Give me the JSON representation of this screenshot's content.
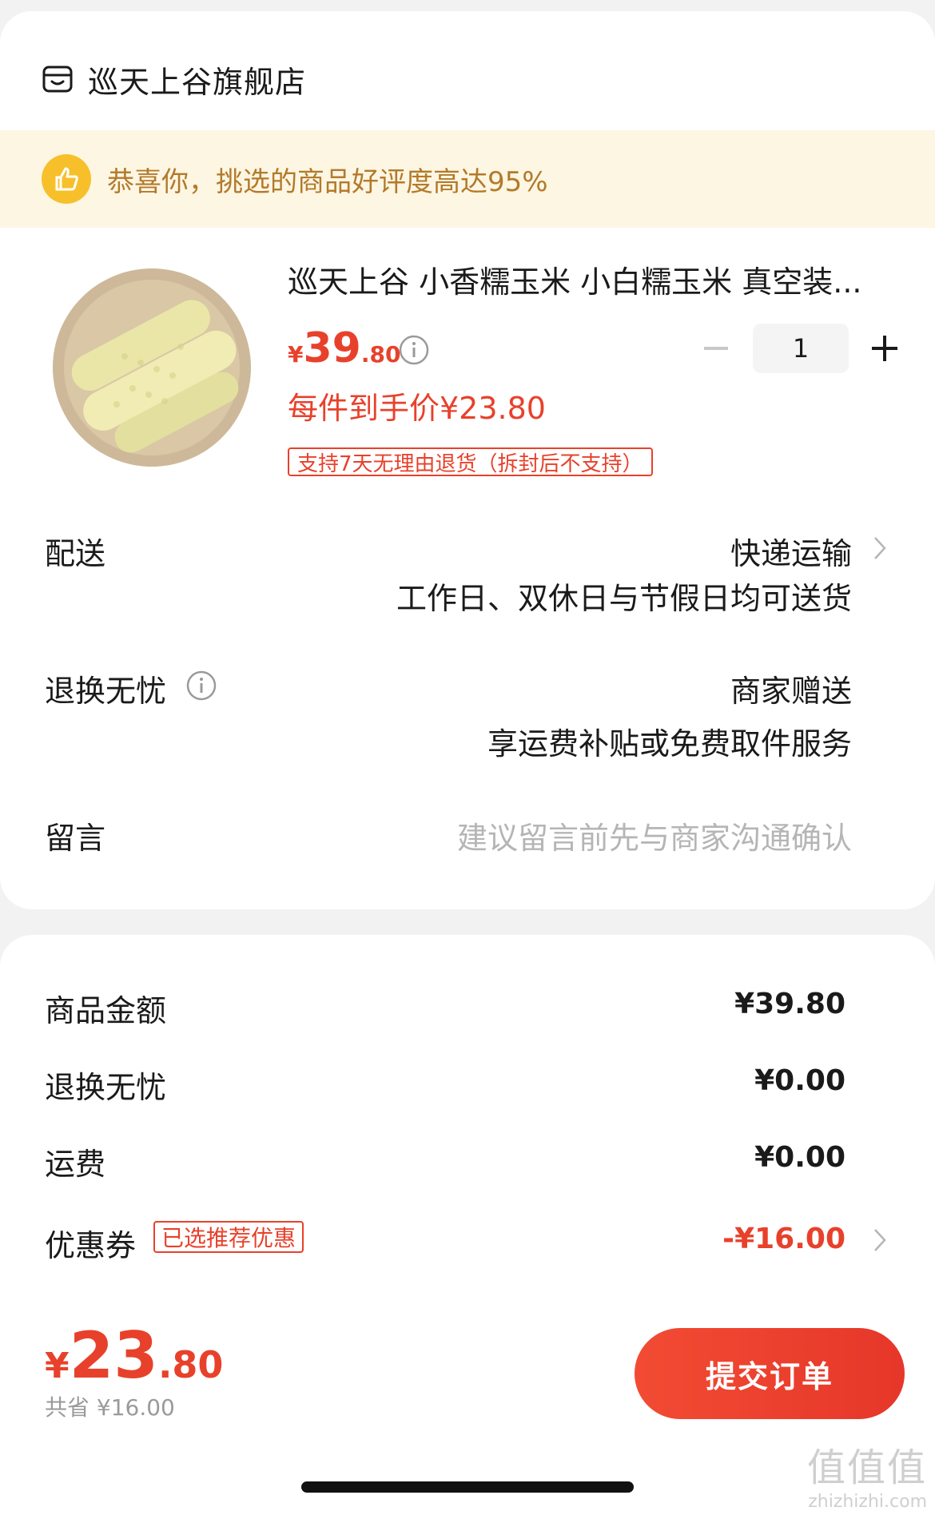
{
  "shop": {
    "name": "巡天上谷旗舰店",
    "icon": "store-icon"
  },
  "banner": {
    "text": "恭喜你，挑选的商品好评度高达95%",
    "icon": "thumbs-up-icon"
  },
  "product": {
    "title": "巡天上谷 小香糯玉米 小白糯玉米 真空装...",
    "price_yen": "¥",
    "price_int": "39",
    "price_dec": ".80",
    "quantity": "1",
    "unit_price": "每件到手价¥23.80",
    "return_tag": "支持7天无理由退货（拆封后不支持）"
  },
  "delivery": {
    "label": "配送",
    "method": "快递运输",
    "note": "工作日、双休日与节假日均可送货"
  },
  "worry_free": {
    "label": "退换无忧",
    "value": "商家赠送",
    "note": "享运费补贴或免费取件服务"
  },
  "message": {
    "label": "留言",
    "placeholder": "建议留言前先与商家沟通确认"
  },
  "summary": {
    "goods_label": "商品金额",
    "goods_value": "¥39.80",
    "worry_label": "退换无忧",
    "worry_value": "¥0.00",
    "shipping_label": "运费",
    "shipping_value": "¥0.00",
    "coupon_label": "优惠券",
    "coupon_tag": "已选推荐优惠",
    "coupon_value": "-¥16.00"
  },
  "footer": {
    "total_yen": "¥",
    "total_int": "23",
    "total_dec": ".80",
    "saved": "共省 ¥16.00",
    "submit": "提交订单"
  },
  "watermark": {
    "big": "值值值",
    "small": "zhizhizhi.com"
  },
  "colors": {
    "accent": "#e8412b",
    "banner_bg": "#fdf6e3",
    "banner_text": "#b37a2b",
    "gold": "#f7c02b"
  }
}
